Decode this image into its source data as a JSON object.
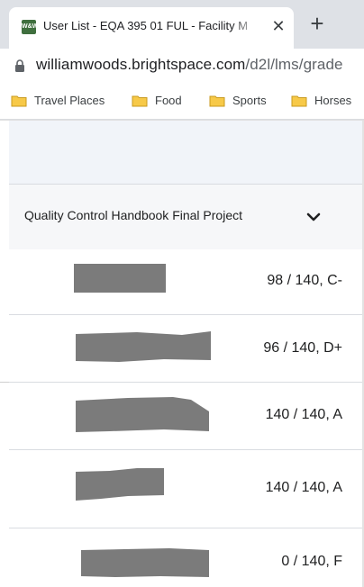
{
  "browser": {
    "tab": {
      "favicon": "W&W",
      "title": "User List - EQA 395 01 FUL - Facility M",
      "close_glyph": "✕"
    },
    "new_tab_glyph": "+",
    "address": {
      "domain": "williamwoods.brightspace.com",
      "path": "/d2l/lms/grade"
    },
    "bookmarks": [
      {
        "label": "Travel Places",
        "icon": "folder-icon"
      },
      {
        "label": "Food",
        "icon": "folder-icon"
      },
      {
        "label": "Sports",
        "icon": "folder-icon"
      },
      {
        "label": "Horses",
        "icon": "folder-icon"
      }
    ]
  },
  "gradebook": {
    "column_header": "Quality Control Handbook Final Project",
    "header_icon": "chevron-down-icon",
    "rows": [
      {
        "name": "",
        "grade": "98 / 140, C-"
      },
      {
        "name": "",
        "grade": "96 / 140, D+"
      },
      {
        "name": "",
        "grade": "140 / 140, A"
      },
      {
        "name": "",
        "grade": "140 / 140, A"
      },
      {
        "name": "",
        "grade": "0 / 140, F"
      }
    ]
  },
  "colors": {
    "tabstrip": "#dee1e6",
    "favicon": "#3f6f3e",
    "folder": "#f7c948",
    "header_bg": "#f6f7f9",
    "redaction": "#7b7b7b"
  }
}
